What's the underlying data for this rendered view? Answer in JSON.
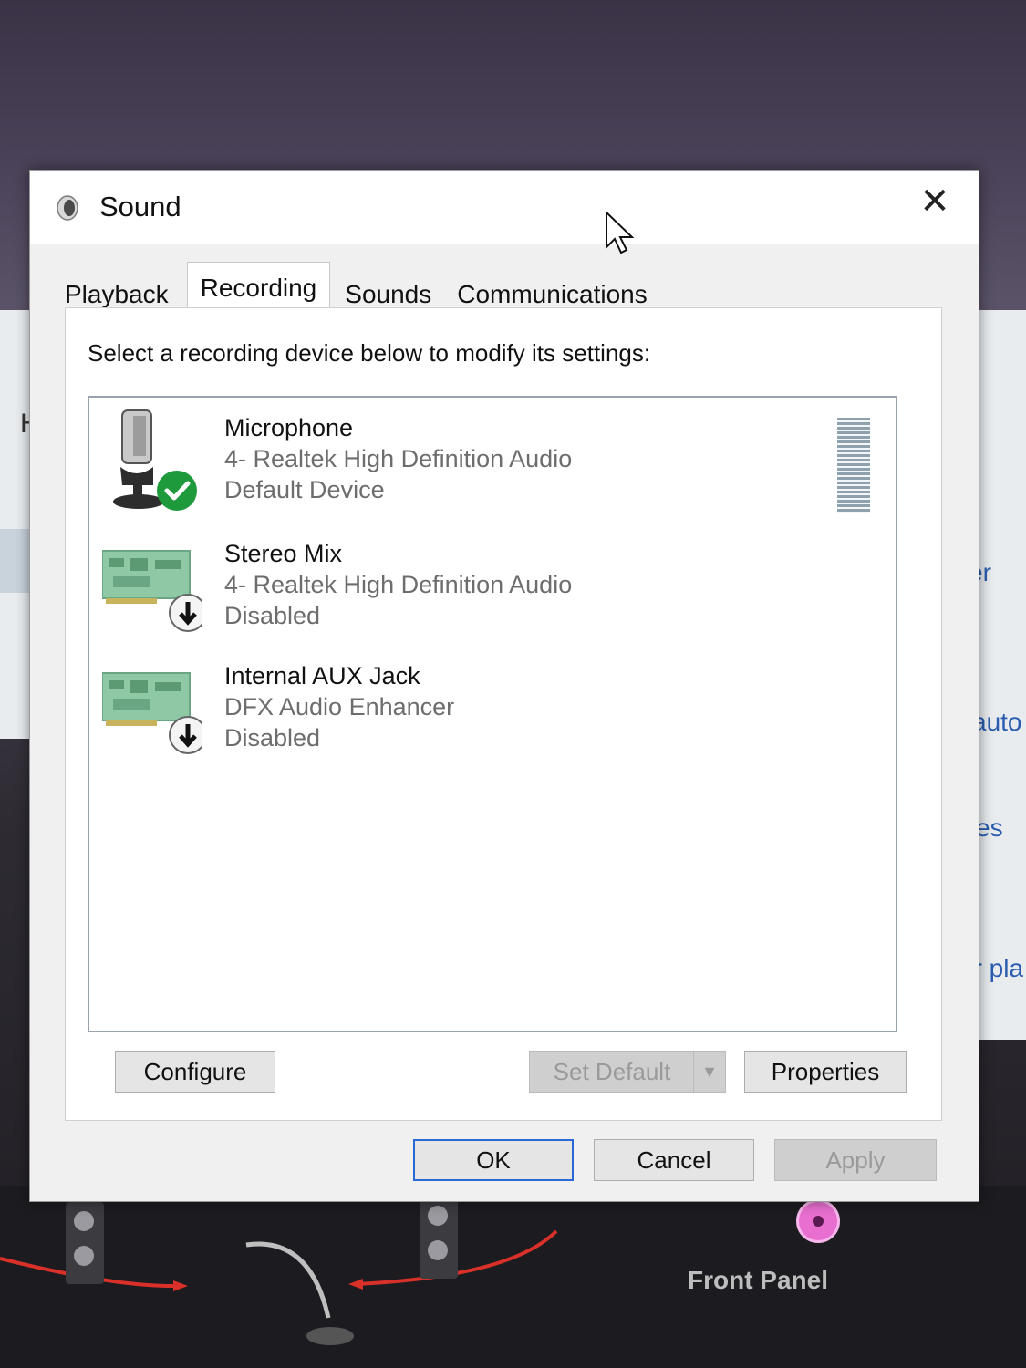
{
  "window": {
    "title": "Sound",
    "close_glyph": "✕"
  },
  "tabs": [
    {
      "label": "Playback",
      "active": false
    },
    {
      "label": "Recording",
      "active": true
    },
    {
      "label": "Sounds",
      "active": false
    },
    {
      "label": "Communications",
      "active": false
    }
  ],
  "panel": {
    "instruction": "Select a recording device below to modify its settings:"
  },
  "devices": [
    {
      "name": "Microphone",
      "driver": "4- Realtek High Definition Audio",
      "status": "Default Device",
      "icon": "microphone-icon",
      "badge": "default-check-icon",
      "selected": false
    },
    {
      "name": "Stereo Mix",
      "driver": "4- Realtek High Definition Audio",
      "status": "Disabled",
      "icon": "sound-card-icon",
      "badge": "disabled-arrow-icon",
      "selected": false
    },
    {
      "name": "Internal AUX Jack",
      "driver": "DFX Audio Enhancer",
      "status": "Disabled",
      "icon": "sound-card-icon",
      "badge": "disabled-arrow-icon",
      "selected": false
    }
  ],
  "buttons": {
    "configure": "Configure",
    "set_default": "Set Default",
    "properties": "Properties",
    "ok": "OK",
    "cancel": "Cancel",
    "apply": "Apply"
  },
  "background": {
    "left_letter": "H",
    "right_fragments": [
      "er",
      "auto",
      "ces",
      "er pla"
    ],
    "front_panel_label": "Front Panel"
  },
  "colors": {
    "accent": "#2b6ad6",
    "check_green": "#1e9a3c",
    "link_blue": "#2a5db0"
  }
}
